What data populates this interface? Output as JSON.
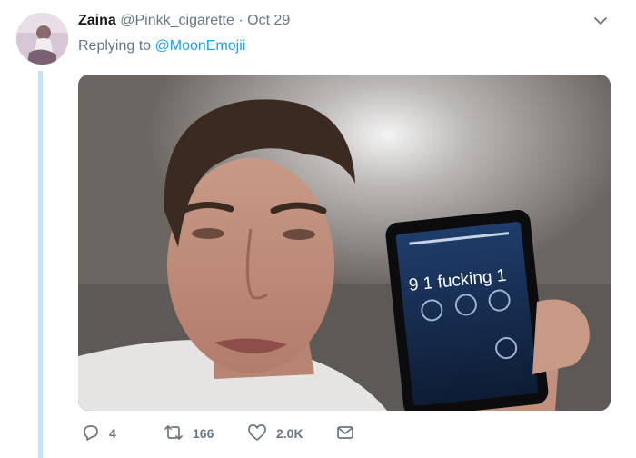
{
  "tweet": {
    "author_name": "Zaina",
    "author_handle": "@Pinkk_cigarette",
    "separator": "·",
    "date": "Oct 29",
    "replying_prefix": "Replying to ",
    "replying_to": "@MoonEmojii",
    "media": {
      "phone_screen_text": "9 1 fucking 1"
    },
    "actions": {
      "replies": "4",
      "retweets": "166",
      "likes": "2.0K"
    }
  },
  "icons": {
    "reply": "reply-icon",
    "retweet": "retweet-icon",
    "like": "heart-icon",
    "dm": "envelope-icon",
    "menu": "chevron-down-icon"
  },
  "colors": {
    "link": "#1da1f2",
    "muted": "#657786",
    "thread_line": "#c4e1f7"
  }
}
